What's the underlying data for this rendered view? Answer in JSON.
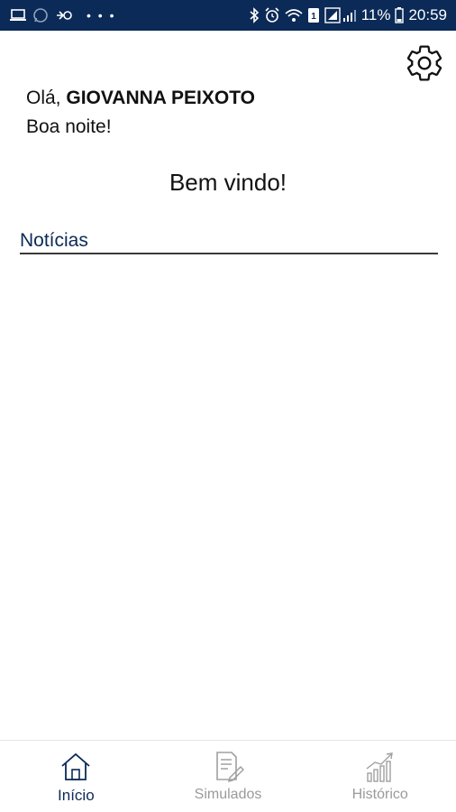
{
  "status_bar": {
    "battery": "11%",
    "time": "20:59",
    "left_icons": [
      "laptop-icon",
      "whatsapp-icon",
      "sync-icon",
      "more-dots-icon"
    ],
    "right_icons": [
      "bluetooth-icon",
      "alarm-icon",
      "wifi-icon",
      "sim-icon",
      "signal-icon",
      "battery-icon"
    ]
  },
  "header": {
    "settings_icon": "gear-icon"
  },
  "greeting": {
    "prefix": "Olá,",
    "name": "GIOVANNA PEIXOTO",
    "time_of_day": "Boa noite!"
  },
  "welcome": "Bem vindo!",
  "news": {
    "title": "Notícias"
  },
  "bottom_nav": {
    "items": [
      {
        "label": "Início",
        "icon": "home-icon",
        "active": true
      },
      {
        "label": "Simulados",
        "icon": "document-edit-icon",
        "active": false
      },
      {
        "label": "Histórico",
        "icon": "bar-chart-icon",
        "active": false
      }
    ]
  },
  "colors": {
    "primary": "#0b2a57",
    "inactive": "#9a9a9a",
    "divider": "#3a3a3a"
  }
}
